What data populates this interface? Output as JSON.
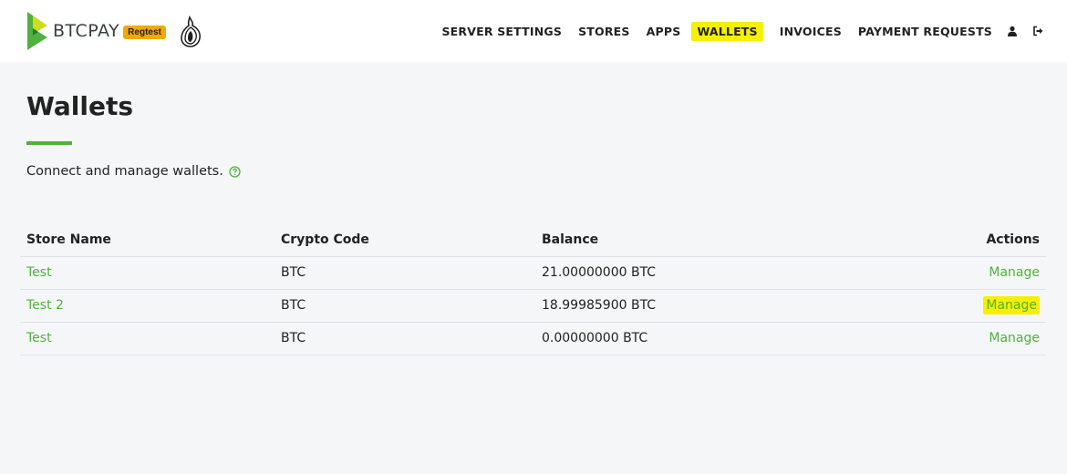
{
  "brand": {
    "name": "BTCPAY",
    "badge": "Regtest"
  },
  "nav": {
    "items": [
      "SERVER SETTINGS",
      "STORES",
      "APPS",
      "WALLETS",
      "INVOICES",
      "PAYMENT REQUESTS"
    ],
    "active": "WALLETS",
    "icons": [
      "user-icon",
      "logout-icon"
    ]
  },
  "page": {
    "title": "Wallets",
    "subtitle": "Connect and manage wallets."
  },
  "table": {
    "headers": [
      "Store Name",
      "Crypto Code",
      "Balance",
      "Actions"
    ],
    "rows": [
      {
        "store": "Test",
        "crypto": "BTC",
        "balance": "21.00000000 BTC",
        "action": "Manage"
      },
      {
        "store": "Test 2",
        "crypto": "BTC",
        "balance": "18.99985900 BTC",
        "action": "Manage"
      },
      {
        "store": "Test",
        "crypto": "BTC",
        "balance": "0.00000000 BTC",
        "action": "Manage"
      }
    ]
  },
  "colors": {
    "accent": "#51b13e",
    "highlight": "#f5f000",
    "badge": "#f2a900"
  }
}
